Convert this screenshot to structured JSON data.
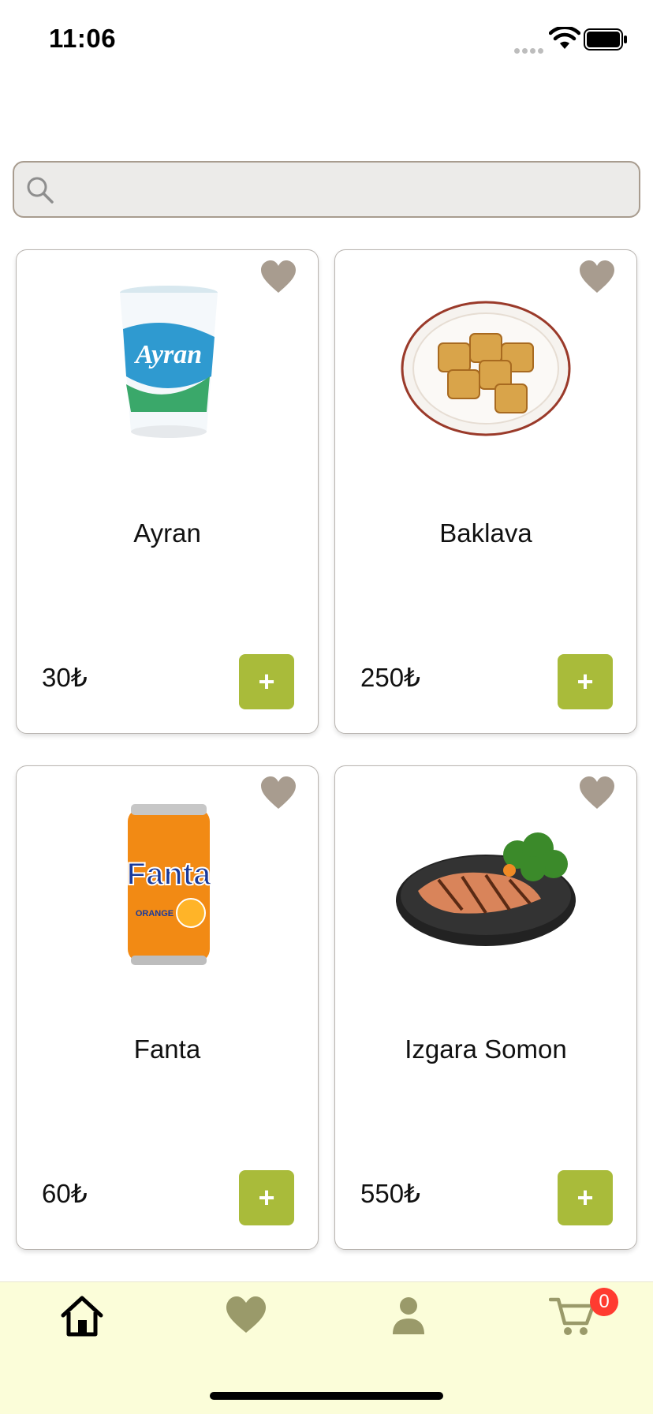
{
  "status_bar": {
    "time": "11:06"
  },
  "search": {
    "placeholder": "",
    "value": ""
  },
  "products": [
    {
      "name": "Ayran",
      "price": "30₺",
      "add_label": "+",
      "image": "ayran-cup",
      "favorite": false
    },
    {
      "name": "Baklava",
      "price": "250₺",
      "add_label": "+",
      "image": "baklava-plate",
      "favorite": false
    },
    {
      "name": "Fanta",
      "price": "60₺",
      "add_label": "+",
      "image": "fanta-can",
      "favorite": false
    },
    {
      "name": "Izgara Somon",
      "price": "550₺",
      "add_label": "+",
      "image": "grilled-salmon",
      "favorite": false
    }
  ],
  "bottom_nav": {
    "items": [
      {
        "icon": "home-icon",
        "active": true
      },
      {
        "icon": "heart-icon",
        "active": false
      },
      {
        "icon": "person-icon",
        "active": false
      },
      {
        "icon": "cart-icon",
        "active": false
      }
    ],
    "cart_count": "0"
  },
  "colors": {
    "accent": "#a9bb3a",
    "nav_background": "#fbfdd9",
    "heart": "#a89c8f",
    "icon_olive": "#9a9a6a",
    "badge": "#ff3b30",
    "search_background": "#ecebe9"
  }
}
